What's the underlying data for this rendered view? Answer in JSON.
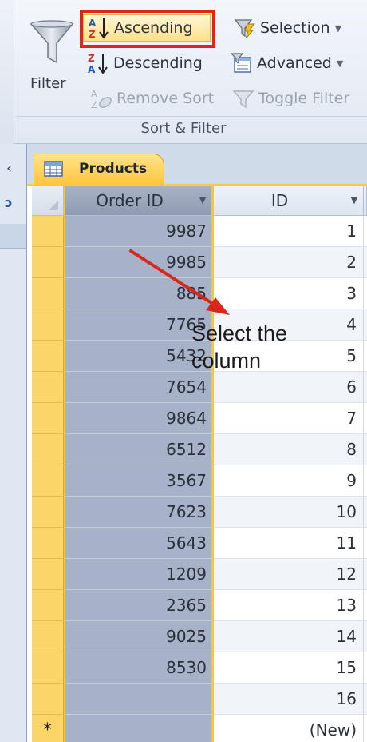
{
  "ribbon": {
    "filter_label": "Filter",
    "ascending_label": "Ascending",
    "descending_label": "Descending",
    "remove_sort_label": "Remove Sort",
    "selection_label": "Selection",
    "advanced_label": "Advanced",
    "toggle_filter_label": "Toggle Filter",
    "group_label": "Sort & Filter",
    "icons": {
      "filter": "funnel-icon",
      "ascending": "sort-ascending-icon",
      "descending": "sort-descending-icon",
      "remove_sort": "remove-sort-icon",
      "selection": "selection-filter-icon",
      "advanced": "advanced-filter-icon",
      "toggle_filter": "toggle-filter-icon"
    }
  },
  "document_tab": {
    "label": "Products",
    "icon": "table-icon"
  },
  "datasheet": {
    "columns": [
      {
        "label": "Order ID",
        "selected": true
      },
      {
        "label": "ID",
        "selected": false
      }
    ],
    "rows": [
      {
        "order_id": "9987",
        "id": "1"
      },
      {
        "order_id": "9985",
        "id": "2"
      },
      {
        "order_id": "885",
        "id": "3"
      },
      {
        "order_id": "7765",
        "id": "4"
      },
      {
        "order_id": "5432",
        "id": "5"
      },
      {
        "order_id": "7654",
        "id": "6"
      },
      {
        "order_id": "9864",
        "id": "7"
      },
      {
        "order_id": "6512",
        "id": "8"
      },
      {
        "order_id": "3567",
        "id": "9"
      },
      {
        "order_id": "7623",
        "id": "10"
      },
      {
        "order_id": "5643",
        "id": "11"
      },
      {
        "order_id": "1209",
        "id": "12"
      },
      {
        "order_id": "2365",
        "id": "13"
      },
      {
        "order_id": "9025",
        "id": "14"
      },
      {
        "order_id": "8530",
        "id": "15"
      },
      {
        "order_id": "",
        "id": "16"
      }
    ],
    "new_row": {
      "marker": "*",
      "id": "(New)"
    }
  },
  "annotation": {
    "line1": "Select the",
    "line2": "column"
  },
  "colors": {
    "highlight_box": "#d9271c",
    "selected_column": "#a7b1c7",
    "row_selector": "#fbd46a",
    "tab_active": "#ffc43a",
    "arrow": "#d9271c"
  }
}
